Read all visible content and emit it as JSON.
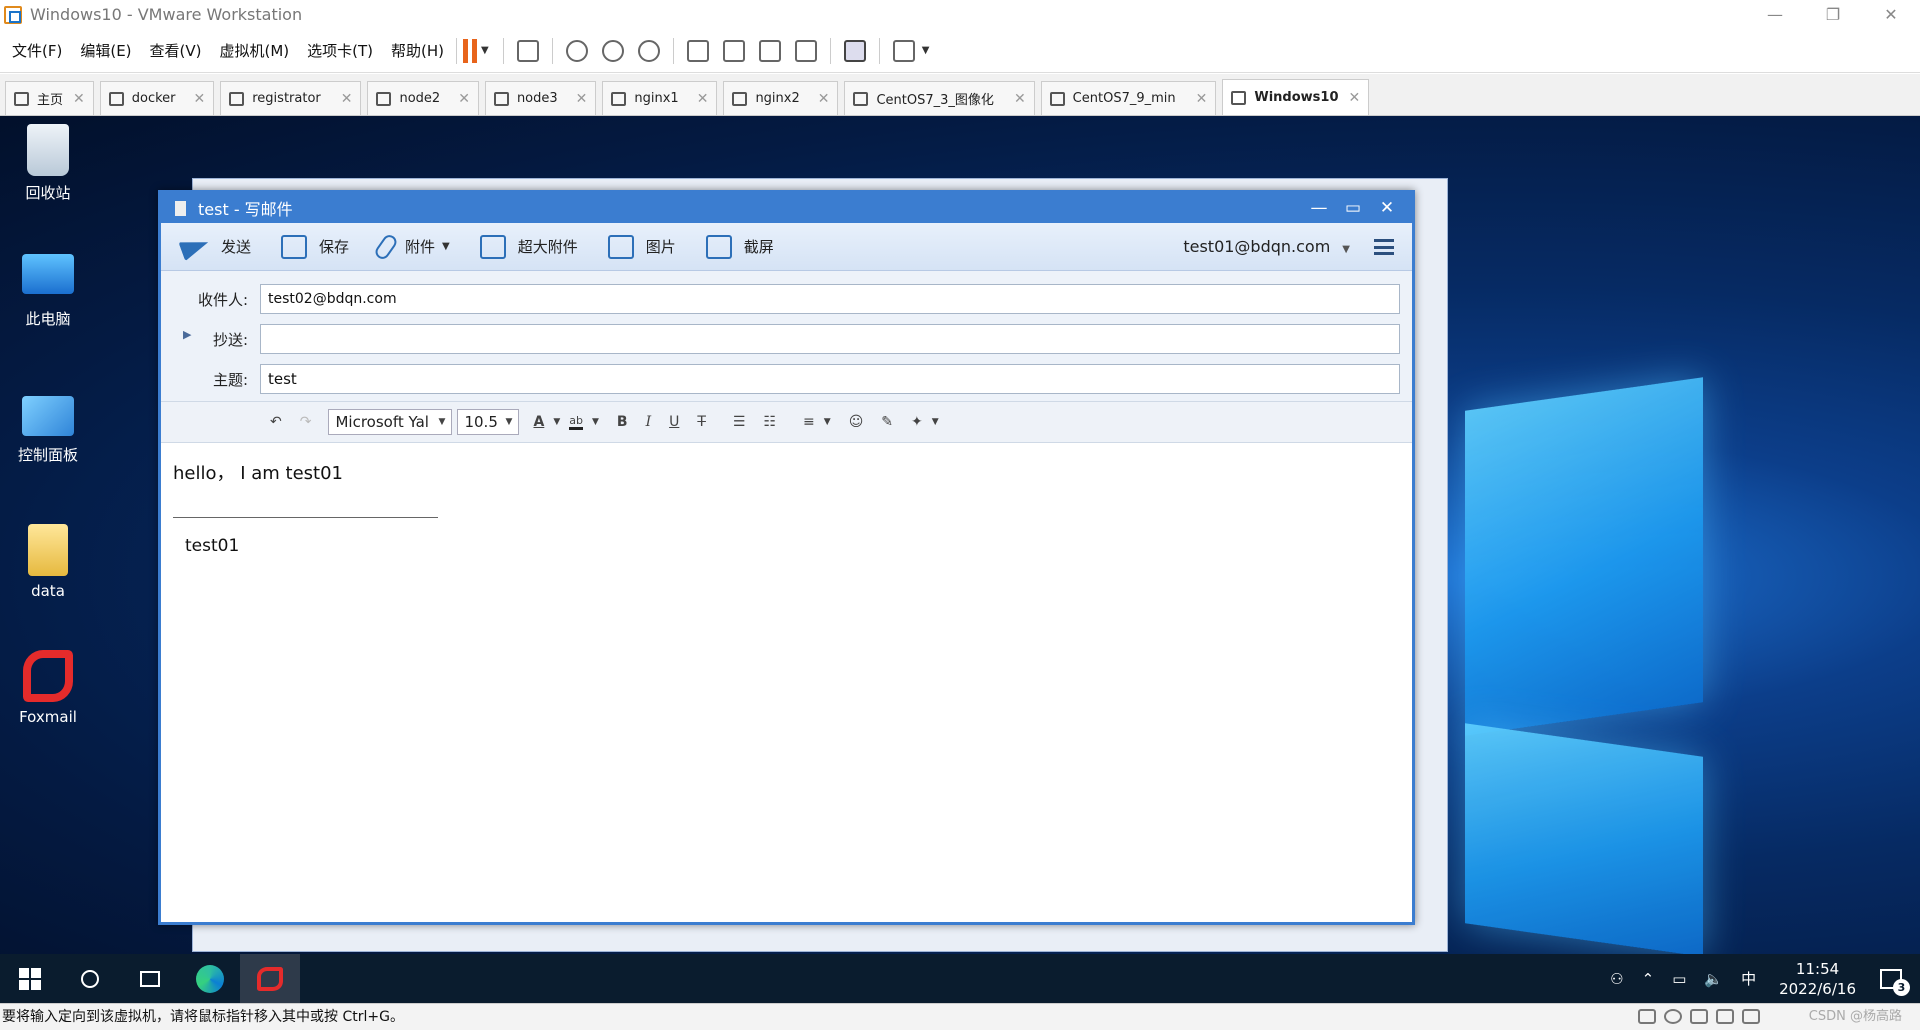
{
  "window": {
    "title": "Windows10 - VMware Workstation"
  },
  "menu": [
    "文件(F)",
    "编辑(E)",
    "查看(V)",
    "虚拟机(M)",
    "选项卡(T)",
    "帮助(H)"
  ],
  "tabs": [
    {
      "label": "主页",
      "icon": "home-icon"
    },
    {
      "label": "docker",
      "icon": "vm-icon"
    },
    {
      "label": "registrator",
      "icon": "vm-icon"
    },
    {
      "label": "node2",
      "icon": "vm-icon"
    },
    {
      "label": "node3",
      "icon": "vm-icon"
    },
    {
      "label": "nginx1",
      "icon": "vm-icon"
    },
    {
      "label": "nginx2",
      "icon": "vm-icon"
    },
    {
      "label": "CentOS7_3_图像化",
      "icon": "vm-icon"
    },
    {
      "label": "CentOS7_9_min",
      "icon": "vm-icon"
    },
    {
      "label": "Windows10",
      "icon": "vm-icon",
      "active": true
    }
  ],
  "desktop": {
    "icons": [
      {
        "label": "回收站"
      },
      {
        "label": "此电脑"
      },
      {
        "label": "控制面板"
      },
      {
        "label": "data"
      },
      {
        "label": "Foxmail"
      }
    ]
  },
  "compose": {
    "title": "test - 写邮件",
    "toolbar": {
      "send": "发送",
      "save": "保存",
      "attach": "附件",
      "big_attach": "超大附件",
      "image": "图片",
      "screenshot": "截屏",
      "account": "test01@bdqn.com"
    },
    "fields": {
      "to_label": "收件人:",
      "to_value": "test02@bdqn.com",
      "cc_label": "抄送:",
      "cc_value": "",
      "subject_label": "主题:",
      "subject_value": "test"
    },
    "format": {
      "font": "Microsoft Yal",
      "size": "10.5"
    },
    "body": {
      "line1": "hello， I am test01",
      "signature": "test01"
    }
  },
  "taskbar": {
    "time": "11:54",
    "date": "2022/6/16",
    "ime": "中",
    "notifications": "3"
  },
  "status": {
    "text": "要将输入定向到该虚拟机，请将鼠标指针移入其中或按 Ctrl+G。",
    "watermark": "CSDN @杨高路"
  },
  "colors": {
    "accent": "#3b7dd0",
    "pause": "#e8641b",
    "foxmail": "#e52b2b"
  }
}
